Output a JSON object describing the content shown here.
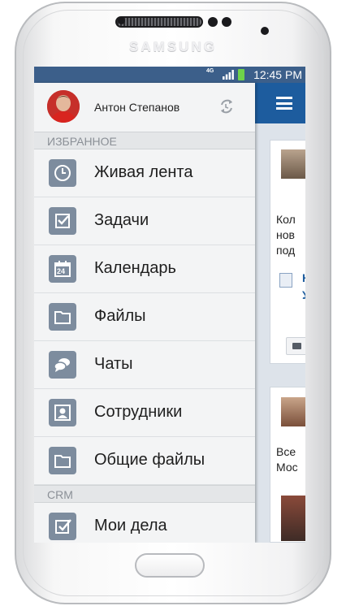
{
  "device": {
    "brand": "SAMSUNG"
  },
  "status_bar": {
    "time": "12:45 PM",
    "network": "4G"
  },
  "drawer": {
    "user_name": "Антон Степанов",
    "sections": [
      {
        "title": "ИЗБРАННОЕ",
        "items": [
          {
            "label": "Живая лента",
            "icon": "clock-icon"
          },
          {
            "label": "Задачи",
            "icon": "checkbox-icon"
          },
          {
            "label": "Календарь",
            "icon": "calendar-icon"
          },
          {
            "label": "Файлы",
            "icon": "folder-icon"
          },
          {
            "label": "Чаты",
            "icon": "chat-icon"
          },
          {
            "label": "Сотрудники",
            "icon": "employees-icon"
          },
          {
            "label": "Общие файлы",
            "icon": "folder-icon"
          }
        ]
      },
      {
        "title": "CRM",
        "items": [
          {
            "label": "Мои дела",
            "icon": "activity-icon"
          }
        ]
      }
    ],
    "calendar_day": "24"
  },
  "feed": {
    "post1_lines": [
      "Кол",
      "нов",
      "под"
    ],
    "post1_link_lines": [
      "Н",
      "У"
    ],
    "post2_lines": [
      "Все",
      "Мос"
    ]
  },
  "colors": {
    "status_bar": "#3c5f8a",
    "app_bar": "#1d5c9e",
    "drawer_bg": "#f3f4f5",
    "icon_tile": "#7d8c9e"
  }
}
